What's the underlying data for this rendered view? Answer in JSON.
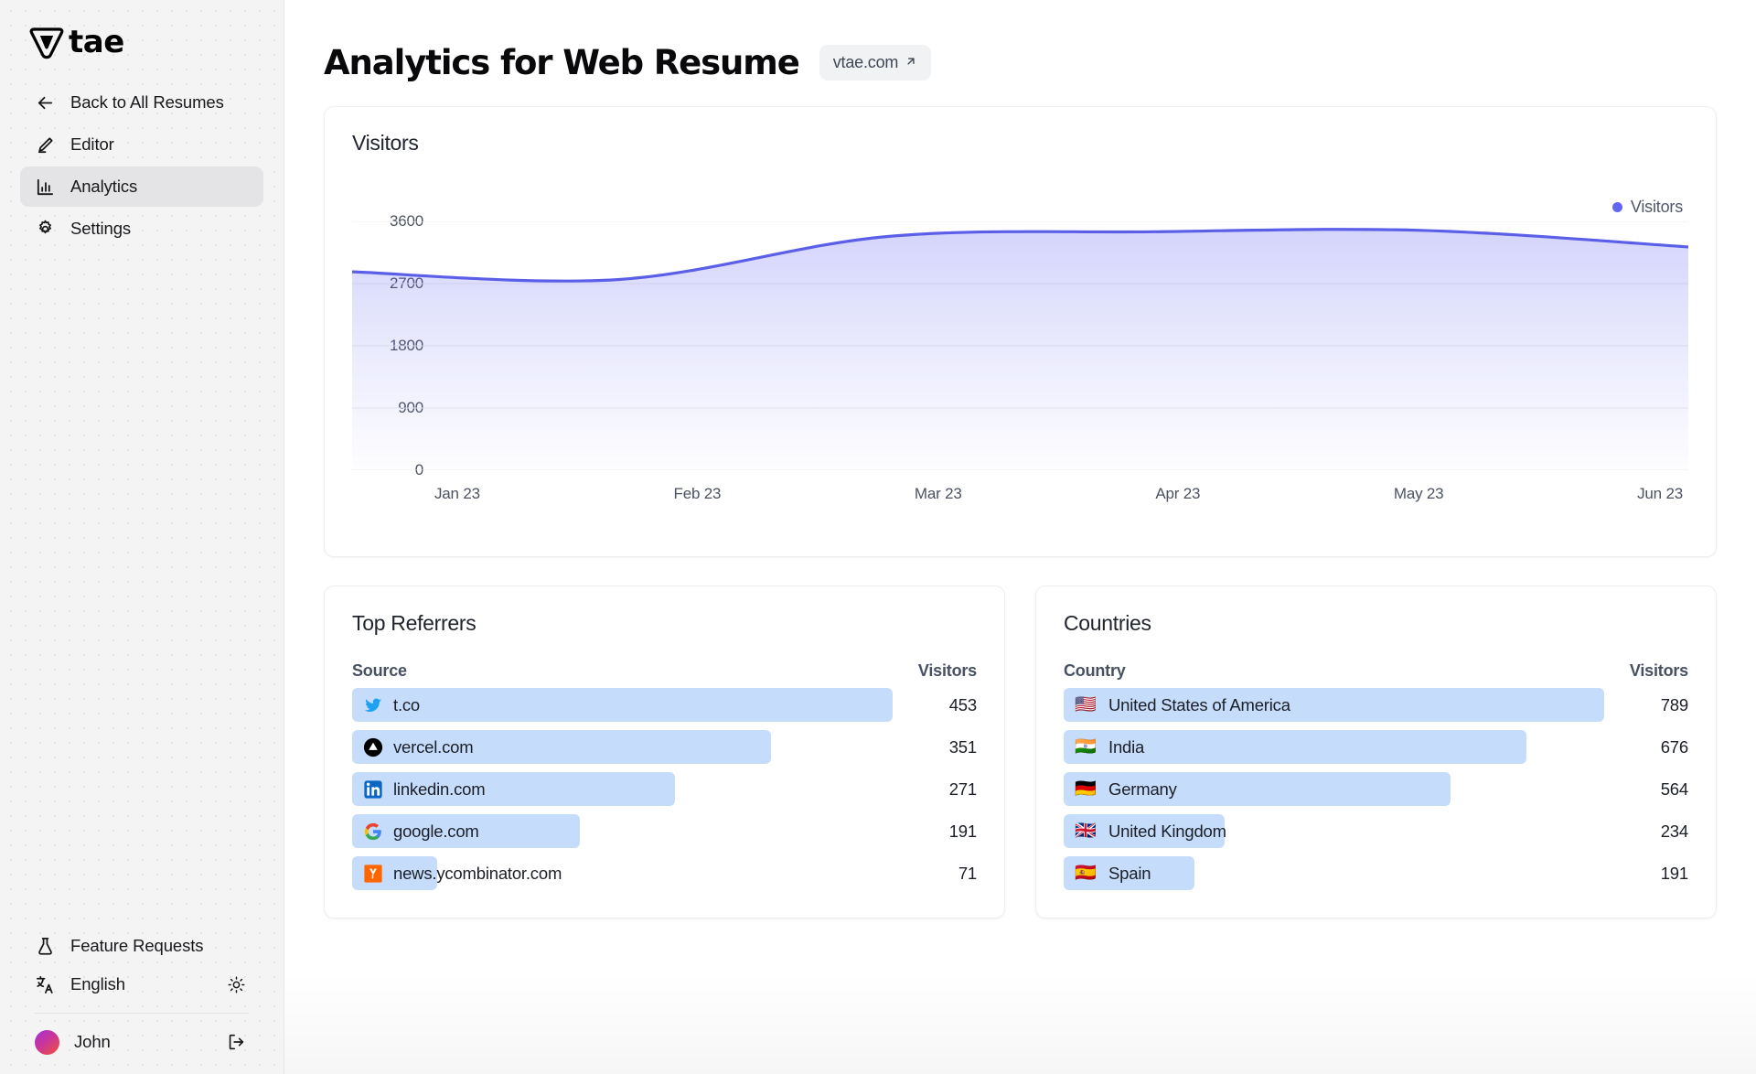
{
  "brand": {
    "logo_letter": "V",
    "wordmark": "tae"
  },
  "sidebar": {
    "items": [
      {
        "label": "Back to All Resumes",
        "icon": "arrow-left-icon",
        "active": false
      },
      {
        "label": "Editor",
        "icon": "pencil-icon",
        "active": false
      },
      {
        "label": "Analytics",
        "icon": "bar-chart-icon",
        "active": true
      },
      {
        "label": "Settings",
        "icon": "gear-icon",
        "active": false
      }
    ],
    "footer": {
      "feature_requests": "Feature Requests",
      "language": "English",
      "theme_toggle_icon": "sun-icon",
      "user_name": "John",
      "logout_icon": "logout-icon"
    }
  },
  "header": {
    "title": "Analytics for Web Resume",
    "site_badge": "vtae.com",
    "site_badge_icon": "external-link-arrow-icon"
  },
  "chart_data": {
    "type": "area",
    "title": "Visitors",
    "legend": [
      "Visitors"
    ],
    "legend_position": "top-right",
    "xlabel": "",
    "ylabel": "",
    "grid": true,
    "ylim": [
      0,
      3600
    ],
    "yticks": [
      0,
      900,
      1800,
      2700,
      3600
    ],
    "ytick_labels": [
      "0",
      "900",
      "1800",
      "2700",
      "3600"
    ],
    "categories": [
      "Jan 23",
      "Feb 23",
      "Mar 23",
      "Apr 23",
      "May 23",
      "Jun 23"
    ],
    "series": [
      {
        "name": "Visitors",
        "color": "#5b5fe8",
        "values": [
          2870,
          2760,
          3380,
          3450,
          3470,
          3230
        ]
      }
    ]
  },
  "referrers": {
    "title": "Top Referrers",
    "col_source": "Source",
    "col_visitors": "Visitors",
    "max": 453,
    "rows": [
      {
        "label": "t.co",
        "value": "453",
        "pct": 100,
        "icon": "twitter-icon"
      },
      {
        "label": "vercel.com",
        "value": "351",
        "pct": 77.5,
        "icon": "vercel-icon"
      },
      {
        "label": "linkedin.com",
        "value": "271",
        "pct": 59.8,
        "icon": "linkedin-icon"
      },
      {
        "label": "google.com",
        "value": "191",
        "pct": 42.2,
        "icon": "google-icon"
      },
      {
        "label": "news.ycombinator.com",
        "value": "71",
        "pct": 15.7,
        "icon": "ycombinator-icon"
      }
    ]
  },
  "countries": {
    "title": "Countries",
    "col_country": "Country",
    "col_visitors": "Visitors",
    "max": 789,
    "rows": [
      {
        "label": "United States of America",
        "value": "789",
        "pct": 100,
        "flag": "🇺🇸"
      },
      {
        "label": "India",
        "value": "676",
        "pct": 85.7,
        "flag": "🇮🇳"
      },
      {
        "label": "Germany",
        "value": "564",
        "pct": 71.5,
        "flag": "🇩🇪"
      },
      {
        "label": "United Kingdom",
        "value": "234",
        "pct": 29.7,
        "flag": "🇬🇧"
      },
      {
        "label": "Spain",
        "value": "191",
        "pct": 24.2,
        "flag": "🇪🇸"
      }
    ]
  },
  "colors": {
    "accent": "#5b5fe8",
    "legend_dot": "#6366f1",
    "bar_fill": "#c6dcfb",
    "sidebar_bg": "#f4f4f5",
    "active_nav": "#e4e4e7"
  }
}
